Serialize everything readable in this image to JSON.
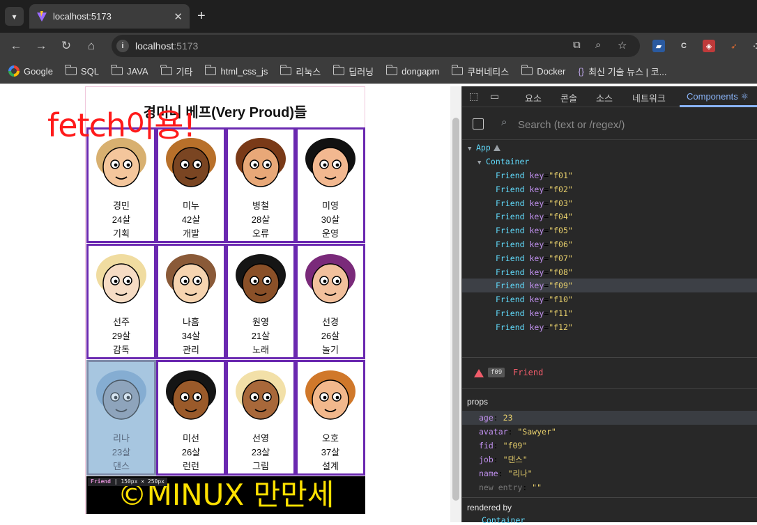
{
  "browser": {
    "tab_title": "localhost:5173",
    "url_host": "localhost",
    "url_port": ":5173",
    "new_tab": "+",
    "tab_close": "✕"
  },
  "bookmarks": [
    {
      "label": "Google",
      "icon": "google-icon"
    },
    {
      "label": "SQL",
      "icon": "folder-icon"
    },
    {
      "label": "JAVA",
      "icon": "folder-icon"
    },
    {
      "label": "기타",
      "icon": "folder-icon"
    },
    {
      "label": "html_css_js",
      "icon": "folder-icon"
    },
    {
      "label": "리눅스",
      "icon": "folder-icon"
    },
    {
      "label": "딥러닝",
      "icon": "folder-icon"
    },
    {
      "label": "dongapm",
      "icon": "folder-icon"
    },
    {
      "label": "쿠버네티스",
      "icon": "folder-icon"
    },
    {
      "label": "Docker",
      "icon": "folder-icon"
    },
    {
      "label": "최신 기술 뉴스 | 코...",
      "icon": "braces-icon"
    }
  ],
  "page": {
    "heading": "경미니 베프(Very Proud)들",
    "overlay_text": "fetch이용!",
    "footer": "©MINUX 만만세",
    "tooltip_name": "Friend",
    "tooltip_size": "150px × 250px"
  },
  "friends": [
    {
      "name": "경민",
      "age": "24살",
      "job": "기획",
      "hair": "#d8b070",
      "skin": "#f4c69c"
    },
    {
      "name": "미누",
      "age": "42살",
      "job": "개발",
      "hair": "#b8702a",
      "skin": "#7a4522"
    },
    {
      "name": "병철",
      "age": "28살",
      "job": "오류",
      "hair": "#7a3a18",
      "skin": "#e8a878"
    },
    {
      "name": "미영",
      "age": "30살",
      "job": "운영",
      "hair": "#111111",
      "skin": "#f2b890"
    },
    {
      "name": "선주",
      "age": "29살",
      "job": "감독",
      "hair": "#f0dca0",
      "skin": "#f6dcc4"
    },
    {
      "name": "나흠",
      "age": "34살",
      "job": "관리",
      "hair": "#8a5a38",
      "skin": "#f6d4b0"
    },
    {
      "name": "원영",
      "age": "21살",
      "job": "노래",
      "hair": "#151515",
      "skin": "#8a5028"
    },
    {
      "name": "선경",
      "age": "26살",
      "job": "놀기",
      "hair": "#7a2a7a",
      "skin": "#f2c09c"
    },
    {
      "name": "리나",
      "age": "23살",
      "job": "댄스",
      "hair": "#6a9ac8",
      "skin": "#7a8aa0"
    },
    {
      "name": "미선",
      "age": "26살",
      "job": "런런",
      "hair": "#151515",
      "skin": "#9a5a2a"
    },
    {
      "name": "선영",
      "age": "23살",
      "job": "그림",
      "hair": "#f2e0a8",
      "skin": "#a8683a"
    },
    {
      "name": "오호",
      "age": "37살",
      "job": "설계",
      "hair": "#d0782a",
      "skin": "#f2b88c"
    }
  ],
  "devtools": {
    "tabs": [
      "요소",
      "콘솔",
      "소스",
      "네트워크",
      "Components ⚛"
    ],
    "search_placeholder": "Search (text or /regex/)",
    "tree": {
      "app": "App",
      "container": "Container",
      "friend_tag": "Friend",
      "key_label": "key",
      "keys": [
        "\"f01\"",
        "\"f02\"",
        "\"f03\"",
        "\"f04\"",
        "\"f05\"",
        "\"f06\"",
        "\"f07\"",
        "\"f08\"",
        "\"f09\"",
        "\"f10\"",
        "\"f11\"",
        "\"f12\""
      ]
    },
    "selected": {
      "key_badge": "f09",
      "name": "Friend"
    },
    "props_title": "props",
    "props": [
      {
        "key": "age",
        "value": "23",
        "kind": "num"
      },
      {
        "key": "avatar",
        "value": "\"Sawyer\"",
        "kind": "str"
      },
      {
        "key": "fid",
        "value": "\"f09\"",
        "kind": "str"
      },
      {
        "key": "job",
        "value": "\"댄스\"",
        "kind": "str"
      },
      {
        "key": "name",
        "value": "\"리나\"",
        "kind": "str"
      },
      {
        "key": "new entry",
        "value": "\"\"",
        "kind": "str"
      }
    ],
    "rendered_by_title": "rendered by",
    "rendered_by": "Container"
  }
}
